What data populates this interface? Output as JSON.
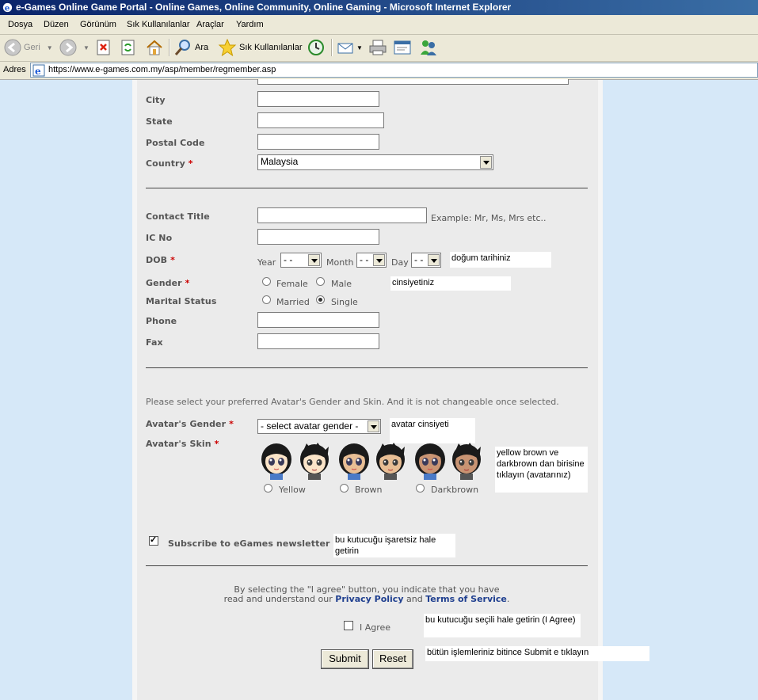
{
  "window": {
    "title": "e-Games Online Game Portal - Online Games, Online Community, Online Gaming - Microsoft Internet Explorer"
  },
  "menu": [
    "Dosya",
    "Düzen",
    "Görünüm",
    "Sık Kullanılanlar",
    "Araçlar",
    "Yardım"
  ],
  "toolbar": {
    "back": "Geri",
    "search": "Ara",
    "favorites": "Sık Kullanılanlar"
  },
  "address": {
    "label": "Adres",
    "url": "https://www.e-games.com.my/asp/member/regmember.asp"
  },
  "form": {
    "city": "City",
    "state": "State",
    "postal": "Postal Code",
    "country": "Country",
    "country_value": "Malaysia",
    "contact_title": "Contact Title",
    "contact_example": "Example: Mr, Ms, Mrs etc..",
    "ic_no": "IC No",
    "dob": "DOB",
    "year": "Year",
    "month": "Month",
    "day": "Day",
    "dob_placeholder": "- -",
    "gender": "Gender",
    "female": "Female",
    "male": "Male",
    "marital": "Marital Status",
    "married": "Married",
    "single": "Single",
    "phone": "Phone",
    "fax": "Fax",
    "req": "*",
    "avatar_intro": "Please select your preferred Avatar's Gender and Skin. And it is not changeable once selected.",
    "avatar_gender": "Avatar's Gender",
    "avatar_gender_value": "- select avatar gender -",
    "avatar_skin": "Avatar's Skin",
    "skins": [
      "Yellow",
      "Brown",
      "Darkbrown"
    ],
    "newsletter": "Subscribe to eGames newsletter",
    "agree_line1": "By selecting the \"I agree\" button, you indicate that you have",
    "agree_line2_pre": "read and understand our",
    "privacy": "Privacy Policy",
    "and": "and",
    "terms": "Terms of Service",
    "period": ".",
    "i_agree": "I Agree",
    "submit": "Submit",
    "reset": "Reset"
  },
  "notes": {
    "dob": "doğum tarihiniz",
    "gender": "cinsiyetiniz",
    "avatar_gender": "avatar cinsiyeti",
    "avatar_skin": "yellow brown ve darkbrown dan birisine tıklayın (avatarınız)",
    "newsletter": "bu kutucuğu işaretsiz hale getirin",
    "agree": "bu kutucuğu seçili hale getirin (I Agree)",
    "submit": "bütün işlemleriniz bitince Submit e tıklayın"
  },
  "state": {
    "single_selected": true,
    "newsletter_checked": true,
    "agree_checked": false
  }
}
